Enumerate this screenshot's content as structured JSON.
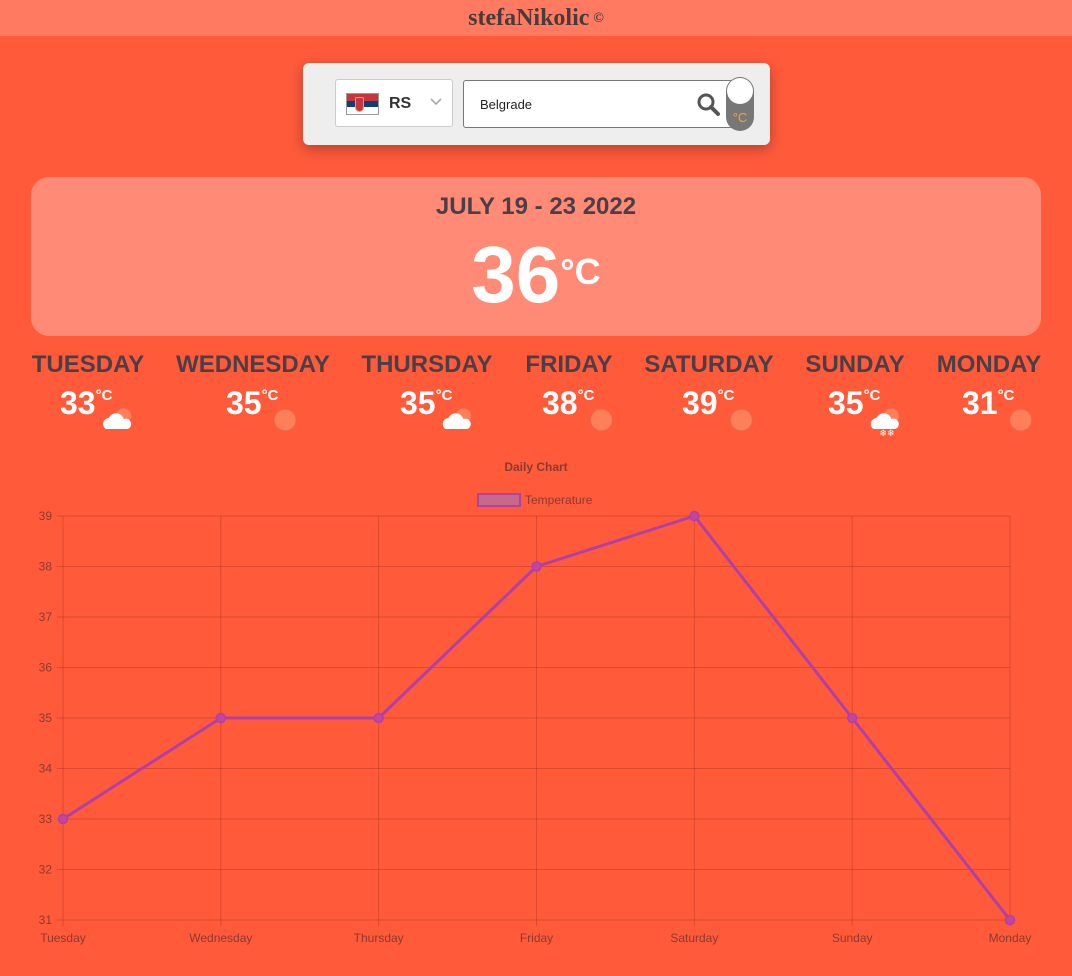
{
  "header": {
    "brand": "stefaNikolic",
    "copyright": "©"
  },
  "search": {
    "country_code": "RS",
    "country_flag": "serbia-flag-icon",
    "city_value": "Belgrade",
    "unit_toggle_label": "°C"
  },
  "hero": {
    "date_range": "JULY 19 - 23 2022",
    "temperature": "36",
    "unit": "°C"
  },
  "forecast": [
    {
      "day": "TUESDAY",
      "temp": "33",
      "unit": "°C",
      "icon": "cloud-sun-icon"
    },
    {
      "day": "WEDNESDAY",
      "temp": "35",
      "unit": "°C",
      "icon": "sun-icon"
    },
    {
      "day": "THURSDAY",
      "temp": "35",
      "unit": "°C",
      "icon": "cloud-sun-icon"
    },
    {
      "day": "FRIDAY",
      "temp": "38",
      "unit": "°C",
      "icon": "sun-icon"
    },
    {
      "day": "SATURDAY",
      "temp": "39",
      "unit": "°C",
      "icon": "sun-icon"
    },
    {
      "day": "SUNDAY",
      "temp": "35",
      "unit": "°C",
      "icon": "snow-cloud-sun-icon"
    },
    {
      "day": "MONDAY",
      "temp": "31",
      "unit": "°C",
      "icon": "sun-icon"
    }
  ],
  "colors": {
    "background": "#ff5b3b",
    "line": "#b03fa8",
    "sun": "#ff7f5a"
  },
  "chart_data": {
    "type": "line",
    "title": "Daily Chart",
    "categories": [
      "Tuesday",
      "Wednesday",
      "Thursday",
      "Friday",
      "Saturday",
      "Sunday",
      "Monday"
    ],
    "series": [
      {
        "name": "Temperature",
        "values": [
          33,
          35,
          35,
          38,
          39,
          35,
          31
        ]
      }
    ],
    "yticks": [
      "31",
      "32",
      "33",
      "34",
      "35",
      "36",
      "37",
      "38",
      "39"
    ],
    "ylim": [
      31,
      39
    ],
    "grid": true,
    "legend": "top-center"
  }
}
